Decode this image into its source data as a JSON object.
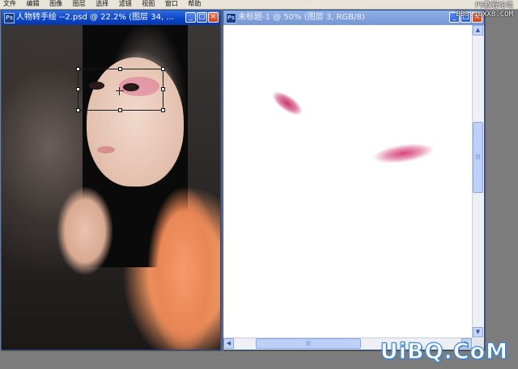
{
  "menubar": {
    "items": [
      "文件",
      "编辑",
      "图像",
      "图层",
      "选择",
      "滤镜",
      "视图",
      "窗口",
      "帮助"
    ]
  },
  "watermark_top": {
    "line1": "PS教程论坛",
    "line2": "BBS.16XX8.COM"
  },
  "left_window": {
    "title": "人物转手绘 --2.psd @ 22.2% (图层 34, ...",
    "minimize_label": "_",
    "maximize_label": "□",
    "close_label": "×"
  },
  "right_window": {
    "title": "未标题-1 @ 50% (图层 3, RGB/8)",
    "minimize_label": "_",
    "maximize_label": "□",
    "close_label": "×",
    "scroll_up": "▲",
    "scroll_down": "▼",
    "scroll_left": "◀",
    "scroll_right": "▶",
    "scroll_grip": "|||"
  },
  "watermark_bottom": "UiBQ.CoM",
  "colors": {
    "title_active": "#0a44c8",
    "title_inactive": "#7697d3",
    "eyeshadow_pink": "#d6447c",
    "workspace_gray": "#7c7c7c"
  }
}
